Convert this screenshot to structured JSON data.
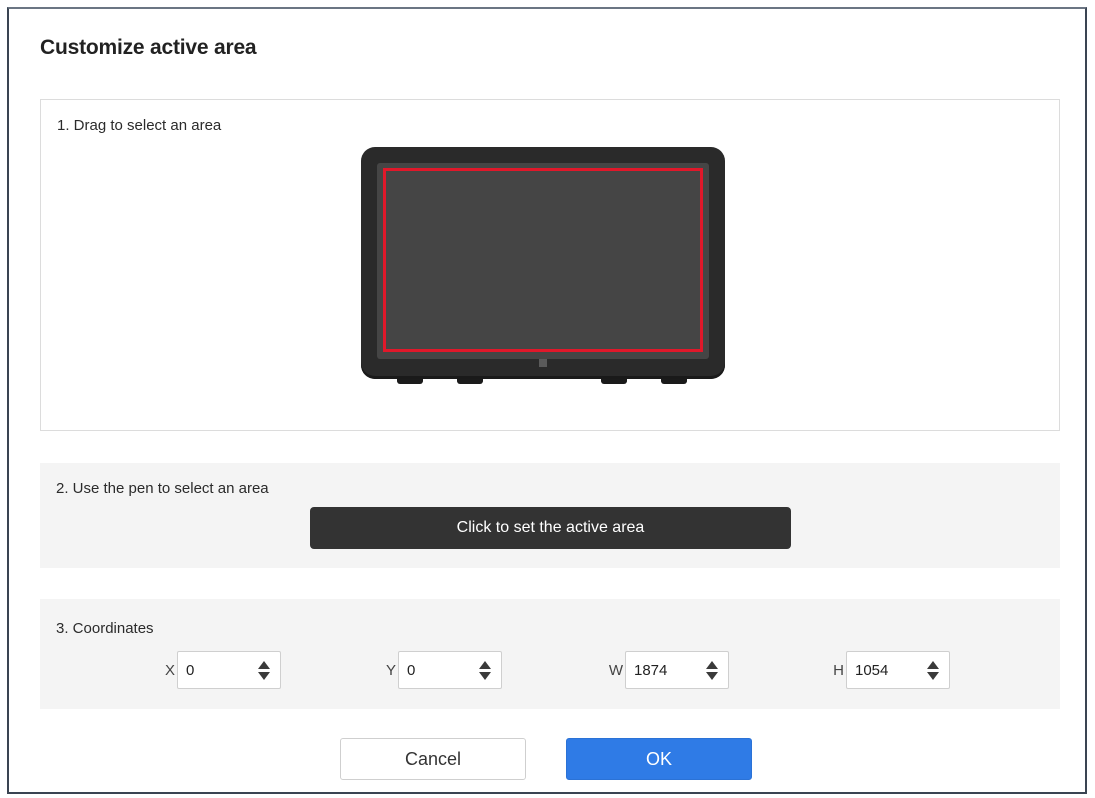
{
  "dialog": {
    "title": "Customize active area"
  },
  "section_drag": {
    "label": "1. Drag to select an area"
  },
  "section_pen": {
    "label": "2. Use the pen to select an area",
    "button_label": "Click to set the active area"
  },
  "section_coordinates": {
    "label": "3. Coordinates",
    "fields": {
      "x": {
        "label": "X",
        "value": "0"
      },
      "y": {
        "label": "Y",
        "value": "0"
      },
      "w": {
        "label": "W",
        "value": "1874"
      },
      "h": {
        "label": "H",
        "value": "1054"
      }
    }
  },
  "footer": {
    "cancel_label": "Cancel",
    "ok_label": "OK"
  },
  "colors": {
    "active_area_border": "#e0182a",
    "ok_button": "#2f7be6",
    "set_button": "#333333"
  },
  "icons": {
    "spinner": "up-down-triangle-icon",
    "tablet": "pen-display-illustration"
  }
}
